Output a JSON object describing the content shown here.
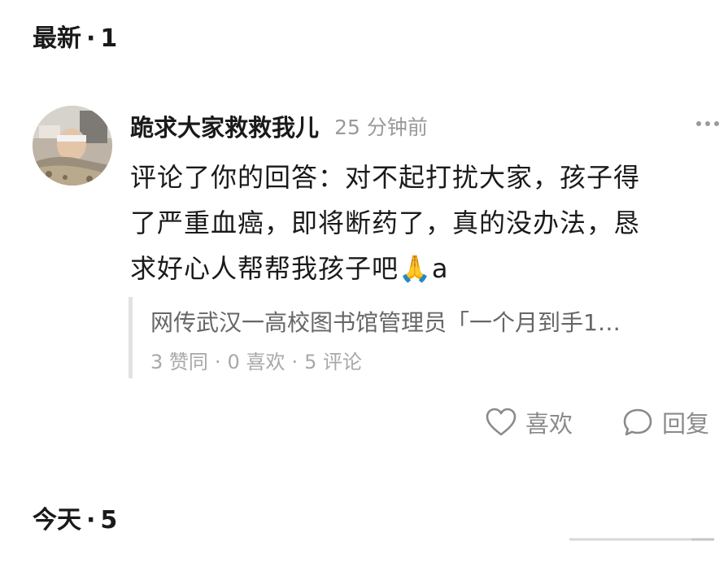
{
  "sections": {
    "latest": {
      "label": "最新",
      "separator": "·",
      "count": "1"
    },
    "today": {
      "label": "今天",
      "separator": "·",
      "count": "5"
    }
  },
  "comment": {
    "author": "跪求大家救救我儿",
    "time": "25 分钟前",
    "more_label": "···",
    "text_lines": [
      "评论了你的回答：对不起打扰大家，孩子得",
      "了严重血癌，即将断药了，真的没办法，恳",
      "求好心人帮帮我孩子吧🙏a"
    ],
    "quoted": {
      "title": "网传武汉一高校图书馆管理员「一个月到手1…",
      "likes": "3 赞同",
      "favs": "0 喜欢",
      "comments": "5 评论",
      "sep": "·"
    },
    "actions": {
      "like": "喜欢",
      "reply": "回复"
    }
  },
  "icons": {
    "avatar": "user-avatar",
    "more": "more-dots-icon",
    "like": "heart-icon",
    "reply": "chat-bubble-icon"
  },
  "colors": {
    "text_primary": "#1a1a1a",
    "text_secondary": "#9a9a9a",
    "quote_border": "#e2e2e2"
  }
}
